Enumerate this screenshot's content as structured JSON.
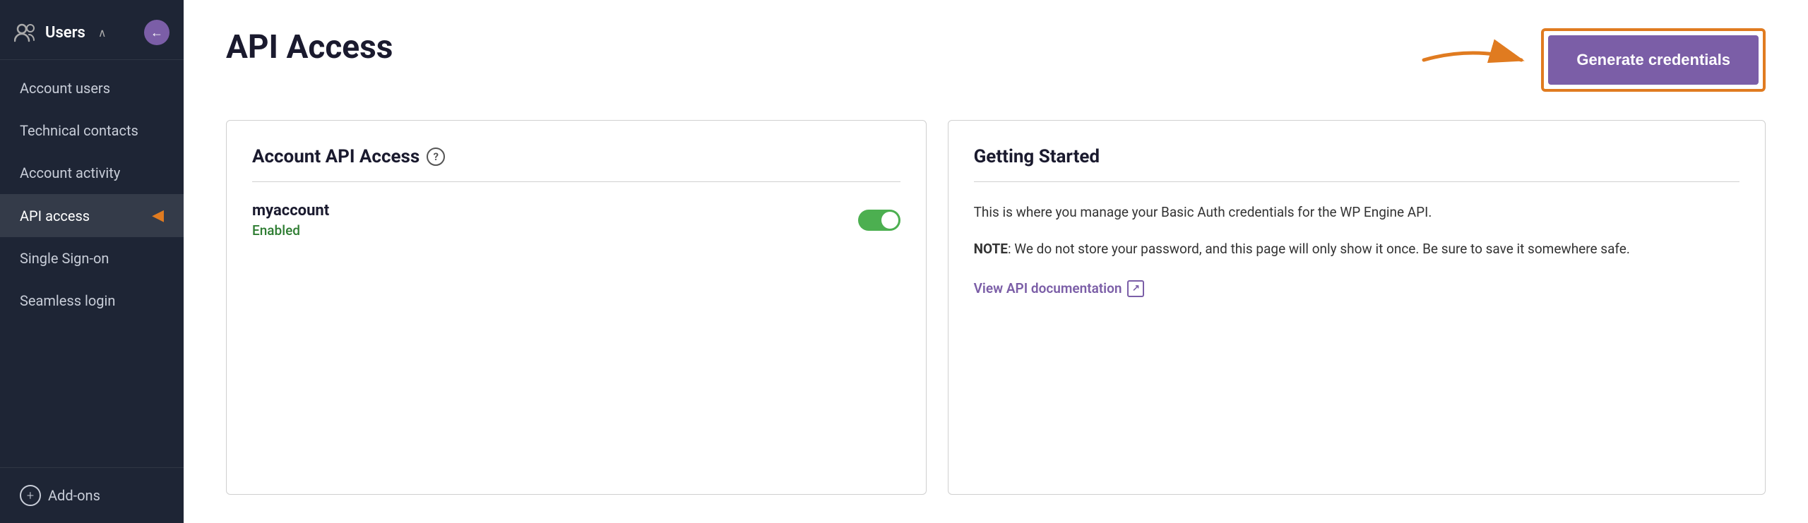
{
  "sidebar": {
    "title": "Users",
    "back_btn_label": "←",
    "nav_items": [
      {
        "id": "account-users",
        "label": "Account users",
        "active": false
      },
      {
        "id": "technical-contacts",
        "label": "Technical contacts",
        "active": false
      },
      {
        "id": "account-activity",
        "label": "Account activity",
        "active": false
      },
      {
        "id": "api-access",
        "label": "API access",
        "active": true
      },
      {
        "id": "single-sign-on",
        "label": "Single Sign-on",
        "active": false
      },
      {
        "id": "seamless-login",
        "label": "Seamless login",
        "active": false
      }
    ],
    "footer": {
      "label": "Add-ons"
    }
  },
  "header": {
    "page_title": "API Access",
    "generate_btn_label": "Generate credentials"
  },
  "left_card": {
    "title": "Account API Access",
    "account_name": "myaccount",
    "account_status": "Enabled",
    "toggle_on": true
  },
  "right_card": {
    "title": "Getting Started",
    "paragraph1": "This is where you manage your Basic Auth credentials for the WP Engine API.",
    "note_prefix": "NOTE",
    "note_text": ": We do not store your password, and this page will only show it once. Be sure to save it somewhere safe.",
    "docs_link_label": "View API documentation"
  }
}
